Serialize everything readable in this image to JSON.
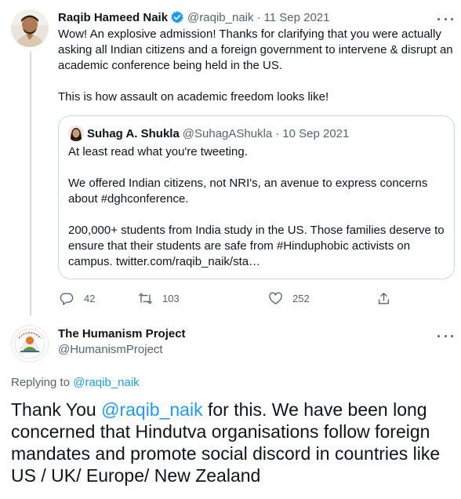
{
  "tweet1": {
    "author_name": "Raqib Hameed Naik",
    "author_handle": "@raqib_naik",
    "separator": "·",
    "date": "11 Sep 2021",
    "text_p1": "Wow! An explosive admission! Thanks for clarifying that you were actually asking all Indian citizens and a foreign government to intervene & disrupt an academic conference being held in the US.",
    "text_p2": "This is how assault on academic freedom looks like!",
    "quote": {
      "author_name": "Suhag A. Shukla",
      "author_handle": "@SuhagAShukla",
      "separator": "·",
      "date": "10 Sep 2021",
      "p1": "At least read what you're tweeting.",
      "p2": "We offered Indian citizens, not NRI's, an avenue to express concerns about #dghconference.",
      "p3": "200,000+ students from India study in the US. Those families deserve to ensure that their students are safe from #Hinduphobic activists on campus. twitter.com/raqib_naik/sta…"
    },
    "actions": {
      "reply_count": "42",
      "retweet_count": "103",
      "like_count": "252"
    }
  },
  "tweet2": {
    "author_name": "The Humanism Project",
    "author_handle": "@HumanismProject",
    "replying_label": "Replying to",
    "replying_handle": "@raqib_naik",
    "text_before": "Thank You ",
    "text_mention": "@raqib_naik",
    "text_after": " for this. We have been long concerned that Hindutva organisations follow foreign mandates and promote social discord in countries like US / UK/ Europe/ New Zealand",
    "avatar_logo_text": "THE HUMANISM PROJECT"
  },
  "colors": {
    "accent": "#1d9bf0",
    "muted": "#536471",
    "text": "#0f1419",
    "border": "#cfd9de"
  },
  "icons": {
    "verified": "verified-badge-icon",
    "reply": "reply-icon",
    "retweet": "retweet-icon",
    "like": "heart-icon",
    "share": "share-icon",
    "more": "more-icon"
  }
}
